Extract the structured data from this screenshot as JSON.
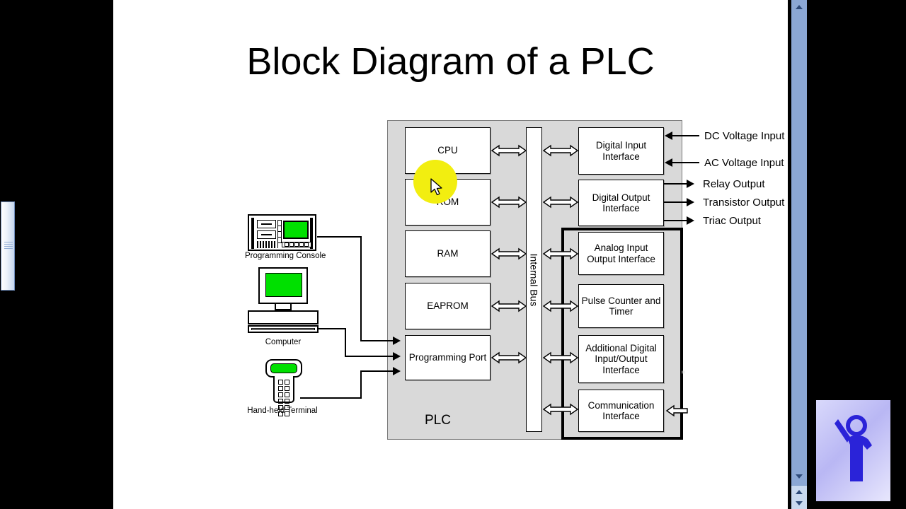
{
  "slide": {
    "title": "Block Diagram of a PLC",
    "plc_label": "PLC",
    "bus_label": "Internal Bus",
    "expansion_mark": "≡"
  },
  "cpu_column": [
    {
      "id": "cpu",
      "label": "CPU"
    },
    {
      "id": "rom",
      "label": "ROM"
    },
    {
      "id": "ram",
      "label": "RAM"
    },
    {
      "id": "eaprom",
      "label": "EAPROM"
    },
    {
      "id": "progport",
      "label": "Programming Port"
    }
  ],
  "io_column": [
    {
      "id": "digital-input-interface",
      "label": "Digital Input Interface"
    },
    {
      "id": "digital-output-interface",
      "label": "Digital Output Interface"
    },
    {
      "id": "analog-io-interface",
      "label": "Analog Input Output Interface"
    },
    {
      "id": "pulse-counter-timer",
      "label": "Pulse Counter and Timer"
    },
    {
      "id": "additional-digital-io",
      "label": "Additional Digital Input/Output Interface"
    },
    {
      "id": "communication-interface",
      "label": "Communication Interface"
    }
  ],
  "io_signals": [
    {
      "id": "dc-voltage-input",
      "label": "DC Voltage Input",
      "direction": "in"
    },
    {
      "id": "ac-voltage-input",
      "label": "AC Voltage Input",
      "direction": "in"
    },
    {
      "id": "relay-output",
      "label": "Relay Output",
      "direction": "out"
    },
    {
      "id": "transistor-output",
      "label": "Transistor Output",
      "direction": "out"
    },
    {
      "id": "triac-output",
      "label": "Triac Output",
      "direction": "out"
    }
  ],
  "peripherals": [
    {
      "id": "programming-console",
      "label": "Programming Console"
    },
    {
      "id": "computer",
      "label": "Computer"
    },
    {
      "id": "handheld-terminal",
      "label": "Hand-held Terminal"
    }
  ],
  "colors": {
    "plc_fill": "#d9d9d9",
    "block_fill": "#ffffff",
    "screen_green": "#00e000",
    "highlight_yellow": "#f2ee10",
    "scrollbar_blue": "#8ba7d4",
    "logo_figure": "#2a23d8"
  }
}
